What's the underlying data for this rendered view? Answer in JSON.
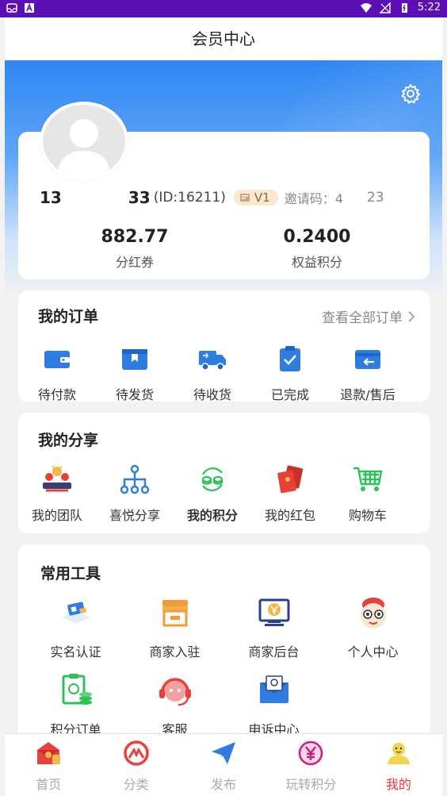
{
  "status_bar": {
    "time": "5:22"
  },
  "header": {
    "title": "会员中心"
  },
  "profile": {
    "phone_start": "13",
    "phone_end": "33",
    "user_id": "(ID:16211)",
    "level": "V1",
    "invite_label": "邀请码：4",
    "invite_end": "23",
    "stats": [
      {
        "value": "882.77",
        "label": "分红券"
      },
      {
        "value": "0.2400",
        "label": "权益积分"
      }
    ]
  },
  "orders": {
    "title": "我的订单",
    "view_all": "查看全部订单",
    "items": [
      {
        "label": "待付款",
        "icon": "wallet-icon"
      },
      {
        "label": "待发货",
        "icon": "package-icon"
      },
      {
        "label": "待收货",
        "icon": "truck-icon"
      },
      {
        "label": "已完成",
        "icon": "clipboard-check-icon"
      },
      {
        "label": "退款/售后",
        "icon": "refund-icon"
      }
    ]
  },
  "share": {
    "title": "我的分享",
    "items": [
      {
        "label": "我的团队",
        "icon": "team-icon"
      },
      {
        "label": "喜悦分享",
        "icon": "hierarchy-icon"
      },
      {
        "label": "我的积分",
        "icon": "points-icon"
      },
      {
        "label": "我的红包",
        "icon": "red-envelope-icon"
      },
      {
        "label": "购物车",
        "icon": "shopping-cart-icon"
      }
    ]
  },
  "tools": {
    "title": "常用工具",
    "items": [
      {
        "label": "实名认证",
        "icon": "id-card-icon"
      },
      {
        "label": "商家入驻",
        "icon": "storefront-icon"
      },
      {
        "label": "商家后台",
        "icon": "monitor-yen-icon"
      },
      {
        "label": "个人中心",
        "icon": "character-face-icon"
      },
      {
        "label": "积分订单",
        "icon": "points-order-icon"
      },
      {
        "label": "客服",
        "icon": "headset-icon"
      },
      {
        "label": "申诉中心",
        "icon": "envelope-icon"
      }
    ]
  },
  "tabbar": {
    "items": [
      {
        "label": "首页",
        "icon": "home-envelope-icon"
      },
      {
        "label": "分类",
        "icon": "category-icon"
      },
      {
        "label": "发布",
        "icon": "paper-plane-icon"
      },
      {
        "label": "玩转积分",
        "icon": "yen-coin-icon"
      },
      {
        "label": "我的",
        "icon": "user-icon",
        "active": true
      }
    ]
  },
  "colors": {
    "accent": "#2f86f2",
    "active_tab": "#ee3333",
    "icon_blue": "#2f7de1",
    "icon_green": "#2bc25a",
    "icon_red": "#e8403a"
  }
}
